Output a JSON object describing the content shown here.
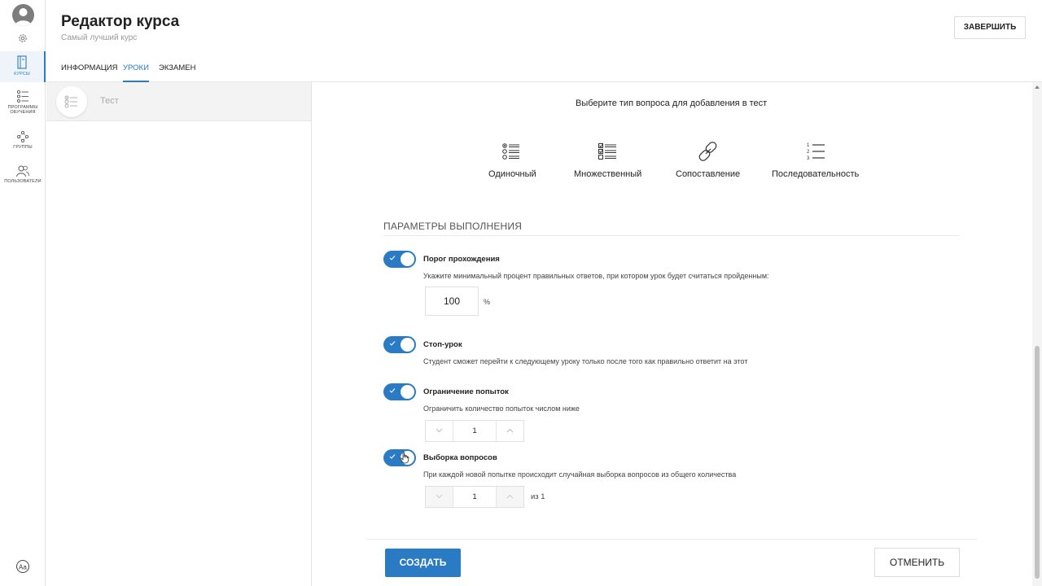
{
  "nav": {
    "items": [
      {
        "label": "КУРСЫ"
      },
      {
        "label": "ПРОГРАММЫ ОБУЧЕНИЯ"
      },
      {
        "label": "ГРУППЫ"
      },
      {
        "label": "ПОЛЬЗОВАТЕЛИ"
      }
    ],
    "bottom_icon": "font-settings-icon"
  },
  "header": {
    "title": "Редактор курса",
    "subtitle": "Самый лучший курс",
    "finish_label": "ЗАВЕРШИТЬ",
    "tabs": [
      {
        "label": "ИНФОРМАЦИЯ",
        "active": false
      },
      {
        "label": "УРОКИ",
        "active": true
      },
      {
        "label": "ЭКЗАМЕН",
        "active": false
      }
    ]
  },
  "lessons": [
    {
      "name": "Тест",
      "icon": "test-icon"
    }
  ],
  "question_types": {
    "title": "Выберите тип вопроса для добавления в тест",
    "items": [
      {
        "label": "Одиночный",
        "icon": "single-choice-icon"
      },
      {
        "label": "Множественный",
        "icon": "multiple-choice-icon"
      },
      {
        "label": "Сопоставление",
        "icon": "matching-icon"
      },
      {
        "label": "Последовательность",
        "icon": "sequence-icon"
      }
    ]
  },
  "params": {
    "section_title": "ПАРАМЕТРЫ ВЫПОЛНЕНИЯ",
    "pass_threshold": {
      "title": "Порог прохождения",
      "desc": "Укажите минимальный процент правильных ответов, при котором урок будет считаться пройденным:",
      "value": "100",
      "unit": "%",
      "enabled": true
    },
    "stop_lesson": {
      "title": "Стоп-урок",
      "desc": "Студент сможет перейти к следующему уроку только после того как правильно ответит на этот",
      "enabled": true
    },
    "attempt_limit": {
      "title": "Ограничение попыток",
      "desc": "Ограничить количество попыток числом ниже",
      "value": "1",
      "enabled": true
    },
    "question_sample": {
      "title": "Выборка вопросов",
      "desc": "При каждой новой попытке происходит случайная выборка вопросов из общего количества",
      "value": "1",
      "of_text": "из 1",
      "enabled": true
    }
  },
  "footer": {
    "create_label": "СОЗДАТЬ",
    "cancel_label": "ОТМЕНИТЬ"
  },
  "colors": {
    "accent": "#2a7bc4",
    "nav_active_bg": "#eef4fa"
  }
}
